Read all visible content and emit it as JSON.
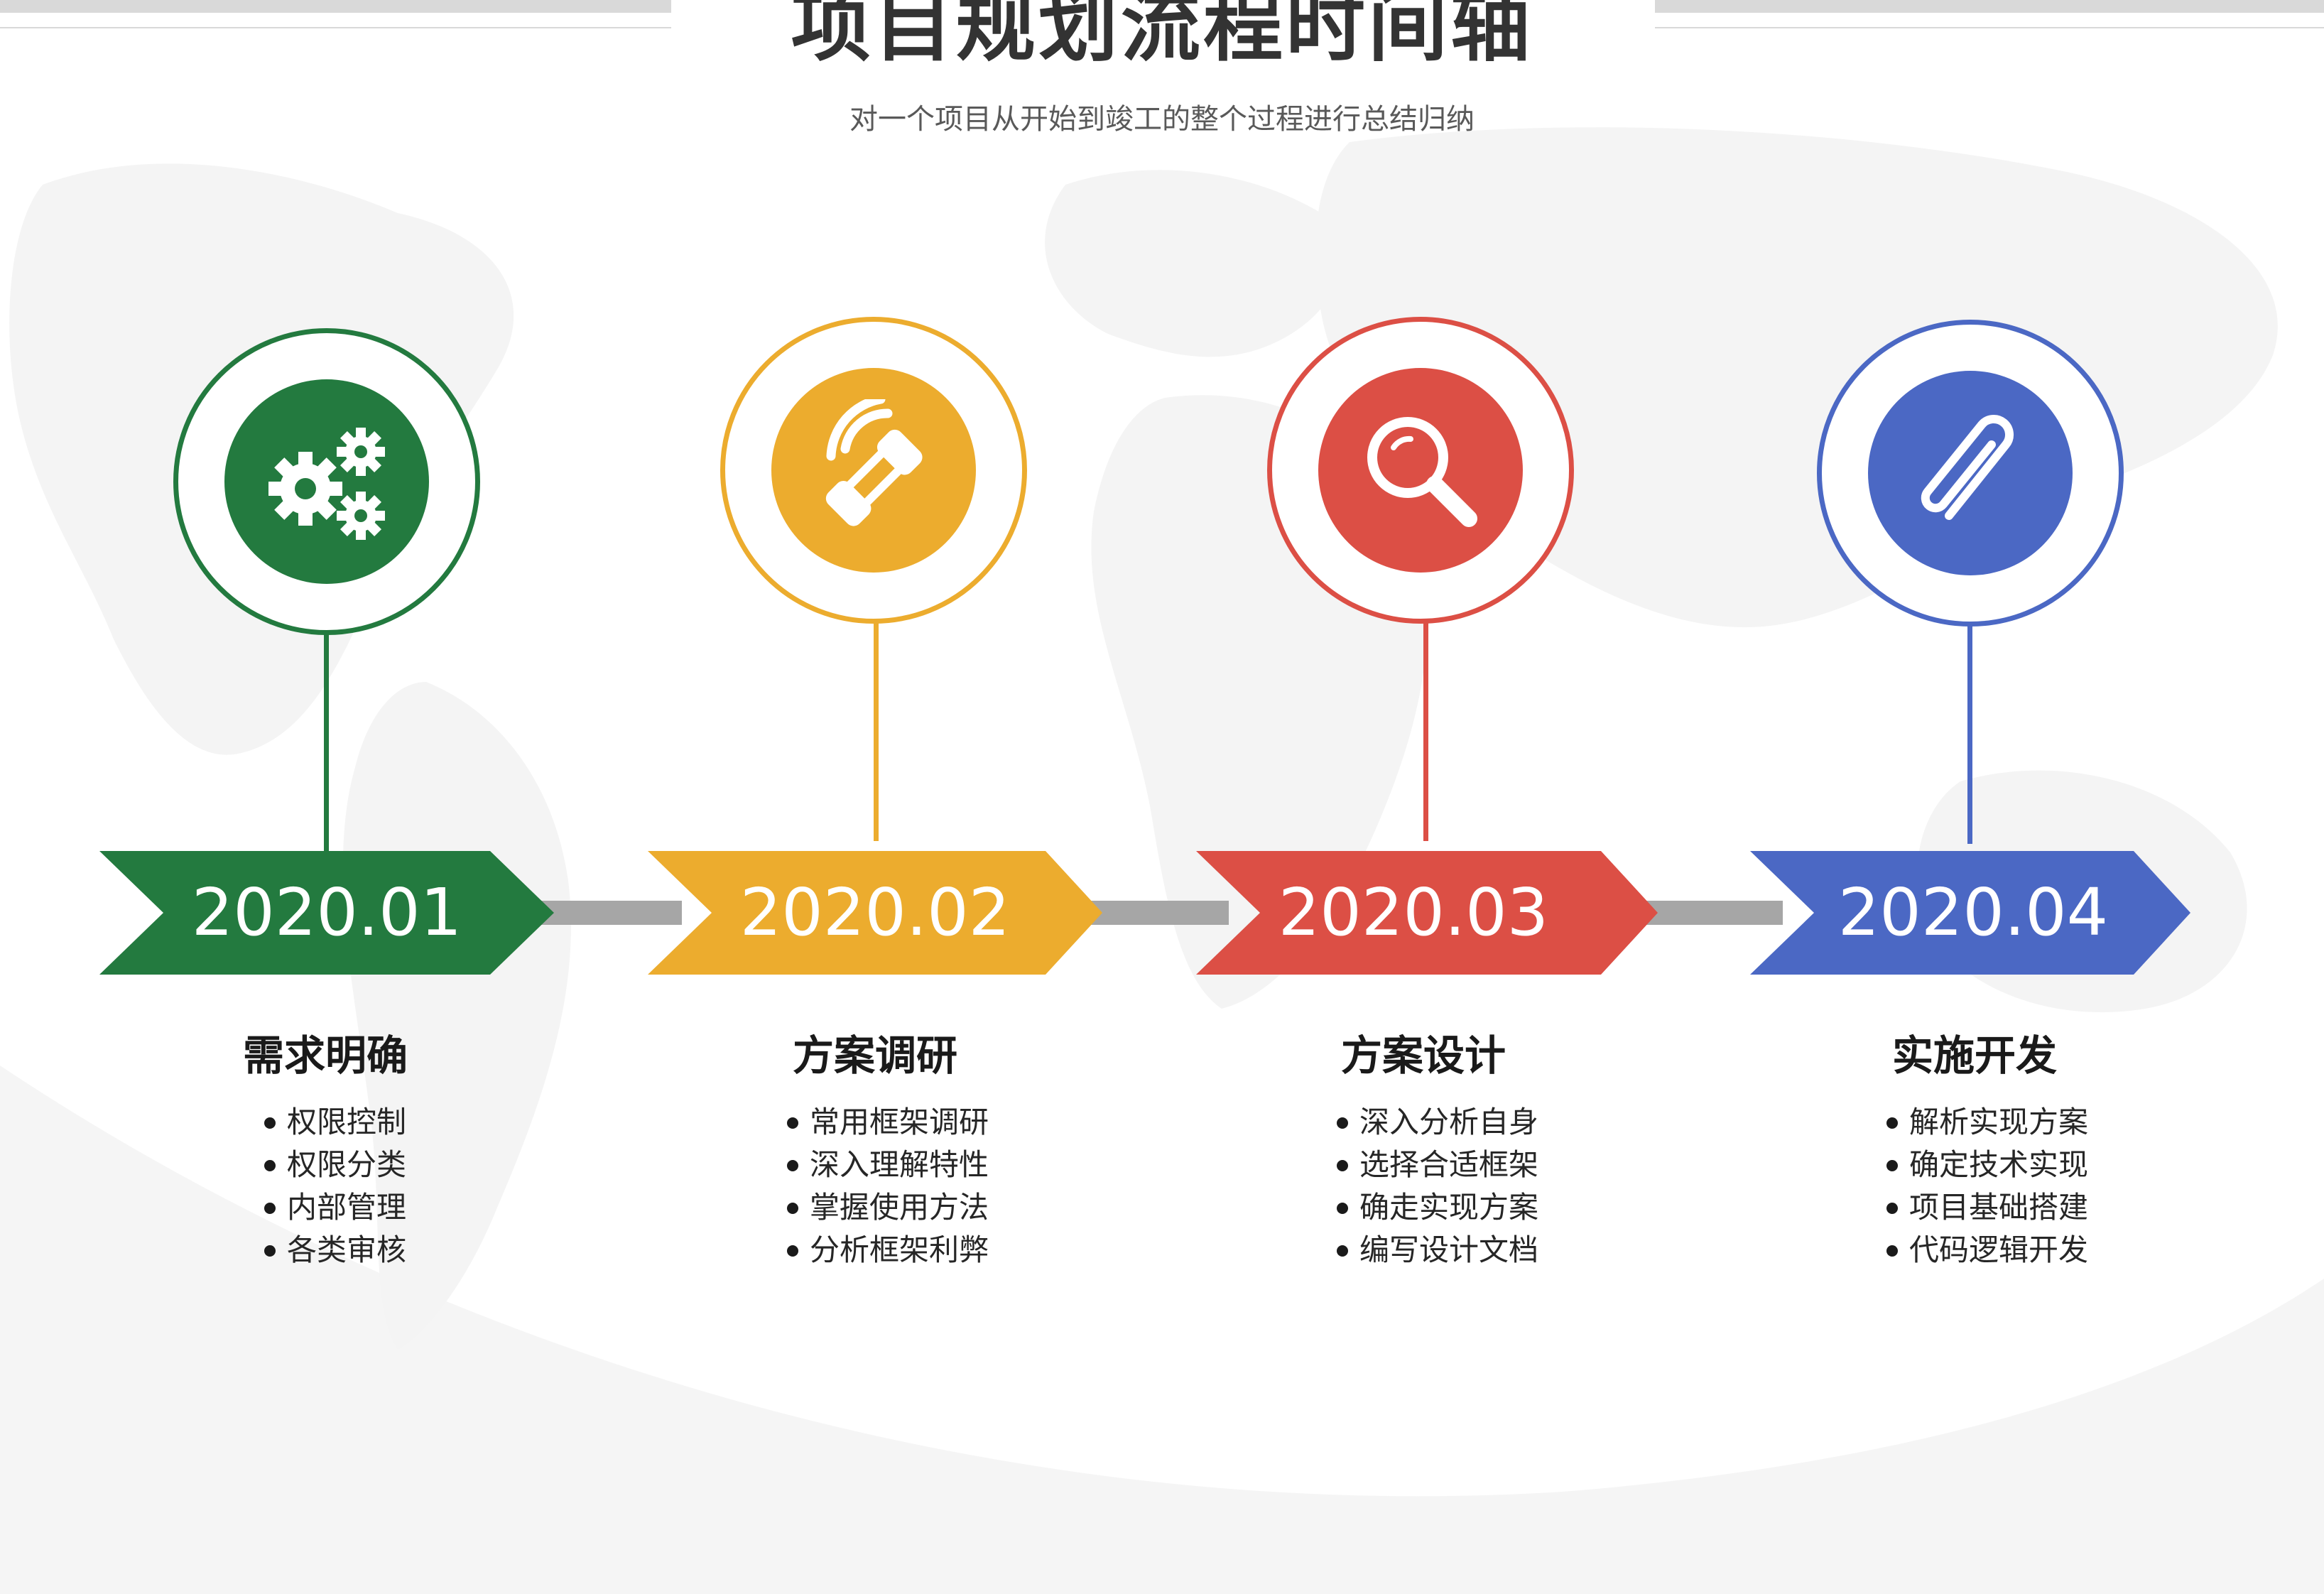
{
  "header": {
    "title": "项目规划流程时间轴",
    "subtitle": "对一个项目从开始到竣工的整个过程进行总结归纳"
  },
  "colors": {
    "step1": "#237a3f",
    "step2": "#ecac2e",
    "step3": "#dc4f45",
    "step4": "#4b68c4",
    "connector": "#a6a6a6",
    "map": "#f3f3f3"
  },
  "steps": [
    {
      "date": "2020.01",
      "title": "需求明确",
      "icon": "gears-icon",
      "items": [
        "权限控制",
        "权限分类",
        "内部管理",
        "各类审核"
      ]
    },
    {
      "date": "2020.02",
      "title": "方案调研",
      "icon": "phone-icon",
      "items": [
        "常用框架调研",
        "深入理解特性",
        "掌握使用方法",
        "分析框架利弊"
      ]
    },
    {
      "date": "2020.03",
      "title": "方案设计",
      "icon": "search-icon",
      "items": [
        "深入分析自身",
        "选择合适框架",
        "确走实现方案",
        "编写设计文档"
      ]
    },
    {
      "date": "2020.04",
      "title": "实施开发",
      "icon": "paperclip-icon",
      "items": [
        "解析实现方案",
        "确定技术实现",
        "项目基础搭建",
        "代码逻辑开发"
      ]
    }
  ]
}
